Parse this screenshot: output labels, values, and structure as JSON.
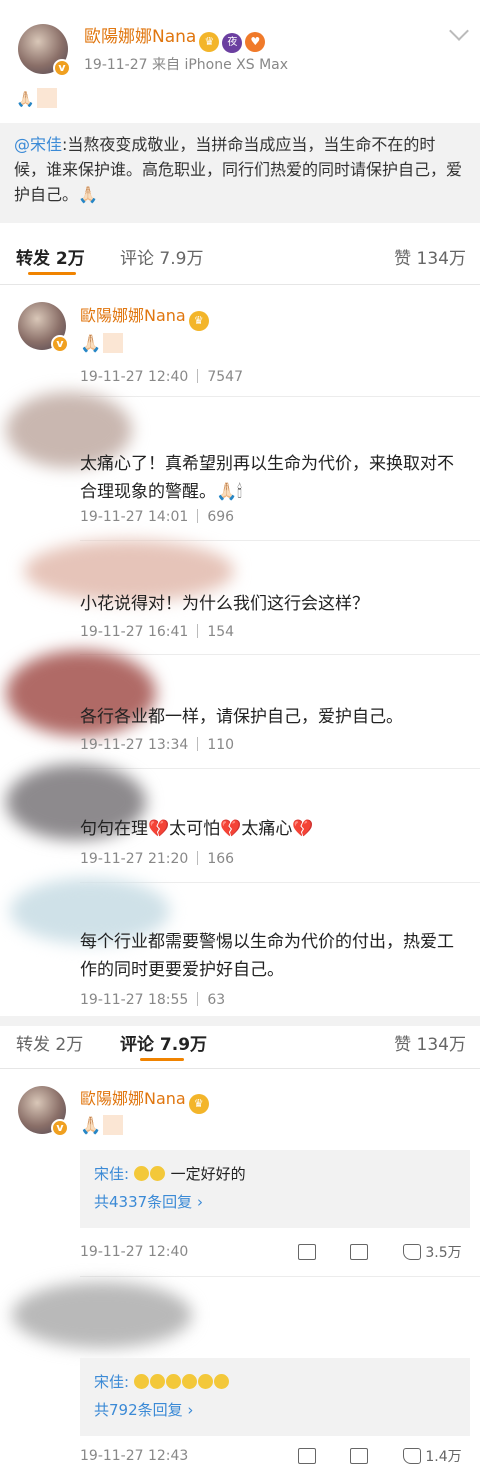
{
  "post": {
    "author": "歐陽娜娜Nana",
    "badges": [
      "crown-icon",
      "night-icon",
      "heart-icon"
    ],
    "night_badge_text": "夜",
    "meta": "19-11-27  来自 iPhone XS Max",
    "text_emoji": "🙏🏻",
    "quote": {
      "mention": "@宋佳",
      "body": ":当熬夜变成敬业，当拼命当成应当，当生命不在的时候，谁来保护谁。高危职业，同行们热爱的同时请保护自己，爱护自己。🙏🏻"
    }
  },
  "tabs_top": {
    "repost": "转发 2万",
    "comment": "评论 7.9万",
    "like": "赞 134万"
  },
  "repost_list": [
    {
      "name": "歐陽娜娜Nana",
      "text": "🙏🏻",
      "time": "19-11-27 12:40",
      "count": "7547"
    },
    {
      "name": "",
      "text": "太痛心了！真希望别再以生命为代价，来换取对不合理现象的警醒。🙏🏻🕯",
      "time": "19-11-27 14:01",
      "count": "696"
    },
    {
      "name": "",
      "text": "小花说得对！为什么我们这行会这样？",
      "time": "19-11-27 16:41",
      "count": "154"
    },
    {
      "name": "",
      "text": "各行各业都一样，请保护自己，爱护自己。",
      "time": "19-11-27 13:34",
      "count": "110"
    },
    {
      "name": "",
      "text": "句句在理💔太可怕💔太痛心💔",
      "time": "19-11-27 21:20",
      "count": "166"
    },
    {
      "name": "",
      "text": "每个行业都需要警惕以生命为代价的付出，热爱工作的同时更要爱护好自己。",
      "time": "19-11-27 18:55",
      "count": "63"
    }
  ],
  "tabs_bottom": {
    "repost": "转发 2万",
    "comment": "评论 7.9万",
    "like": "赞 134万"
  },
  "comment_list": [
    {
      "name": "歐陽娜娜Nana",
      "text": "🙏🏻",
      "reply_who": "宋佳:",
      "reply_text": "一定好好的",
      "reply_more": "共4337条回复 ›",
      "time": "19-11-27 12:40",
      "likes": "3.5万"
    },
    {
      "name": "",
      "text": "",
      "reply_who": "宋佳:",
      "reply_text": "",
      "reply_more": "共792条回复 ›",
      "time": "19-11-27 12:43",
      "likes": "1.4万"
    }
  ]
}
